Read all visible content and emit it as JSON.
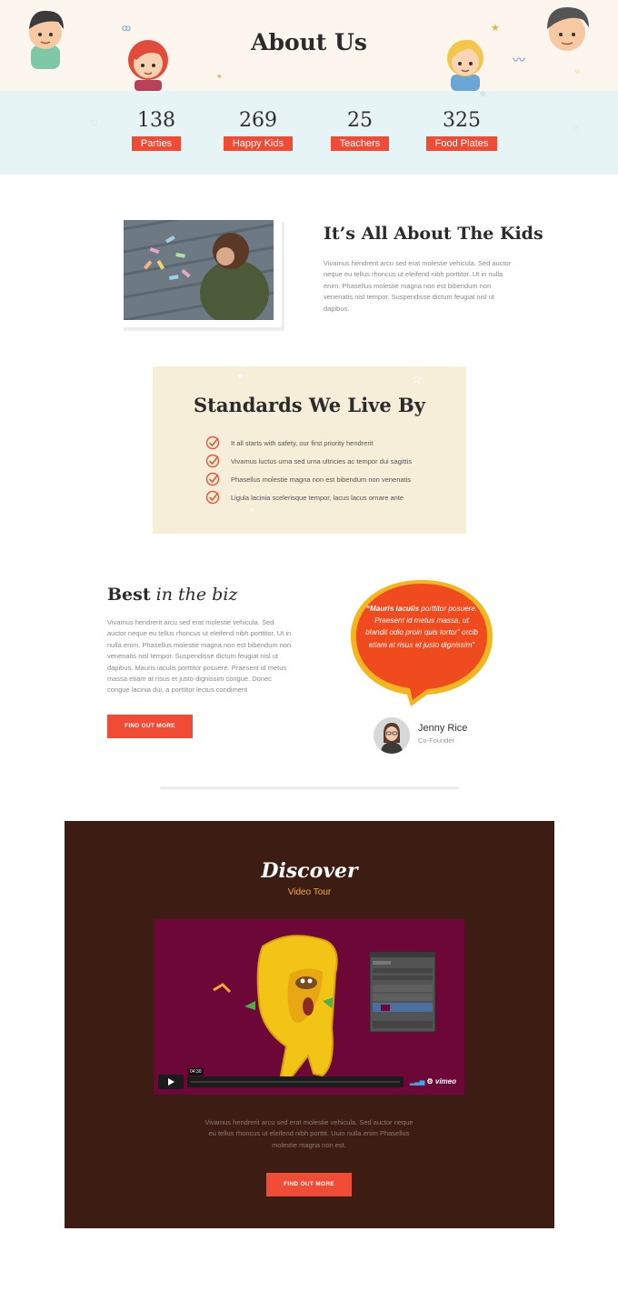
{
  "header": {
    "title": "About Us"
  },
  "stats": [
    {
      "value": "138",
      "label": "Parties"
    },
    {
      "value": "269",
      "label": "Happy Kids"
    },
    {
      "value": "25",
      "label": "Teachers"
    },
    {
      "value": "325",
      "label": "Food Plates"
    }
  ],
  "about_kids": {
    "title_light": "It’s All About ",
    "title_bold": "The Kids",
    "text": "Vivamus hendrerit arcu sed erat molestie vehicula. Sed auctor neque eu tellus rhoncus ut eleifend nibh porttitor. Ut in nulla enim. Phasellus molestie magna non est bibendum non venenatis nisl tempor. Suspendisse dictum feugiat nisl ut dapibus."
  },
  "standards": {
    "title_light": "Standards ",
    "title_bold": "We Live By",
    "items": [
      "It all starts with safety, our first priority hendrerit",
      "Vivamus luctus urna sed urna ultricies ac tempor dui sagittis",
      "Phasellus molestie magna non est bibendum non venenatis",
      "Ligula lacinia scelerisque tempor, lacus lacus ornare ante"
    ]
  },
  "biz": {
    "title_bold": "Best",
    "title_italic": " in the biz",
    "text": "Vivamus hendrerit arcu sed erat molestie vehicula. Sed auctor neque eu tellus rhoncus ut eleifend nibh porttitor. Ut in nulla enim. Phasellus molestie magna non est bibendum non venenatis nisl tempor. Suspendisse dictum feugiat nisl ut dapibus. Mauris iaculis porttitor posuere. Praesent id metus massa etiam at risus et justo dignissim congue. Donec congue lacinia dui, a porttitor lectus condiment",
    "button_label": "FIND OUT MORE",
    "quote_bold": "“Mauris iaculis",
    "quote_rest": " porttitor posuere. Praesent id metus massa, ut blandit odio proin quis tortor” orcib etiam at risus et justo dignissim”",
    "author_name": "Jenny Rice",
    "author_role": "Co-Founder"
  },
  "discover": {
    "title": "Discover",
    "subtitle": "Video Tour",
    "video_time": "04:30",
    "video_brand": "vimeo",
    "text": "Vivamus hendrerit arcu sed erat molestie vehicula. Sed auctor neque eu tellus rhoncus ut eleifend nibh porttit. Uuin nulla enim Phasellus molestie magna non est.",
    "button_label": "FIND OUT MORE"
  },
  "colors": {
    "accent": "#ef4b35",
    "discover_bg": "#3d1d13",
    "standards_bg": "#f7eed9",
    "stats_bg": "#e7f4f6"
  }
}
